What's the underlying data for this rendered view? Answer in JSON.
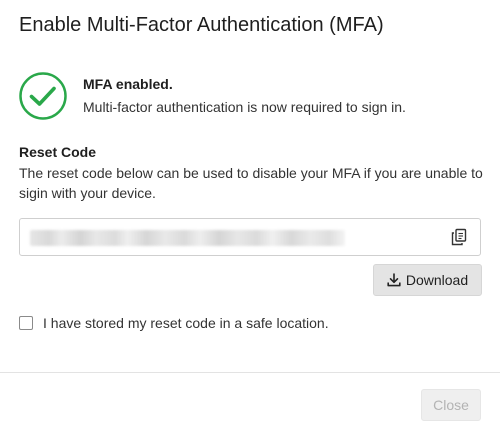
{
  "dialog": {
    "title": "Enable Multi-Factor Authentication (MFA)"
  },
  "status": {
    "icon": "check-circle-icon",
    "heading": "MFA enabled.",
    "description": "Multi-factor authentication is now required to sign in.",
    "color": "#2aa84a"
  },
  "reset_code": {
    "title": "Reset Code",
    "description": "The reset code below can be used to disable your MFA if you are unable to sigin with your device.",
    "value_obscured": true,
    "copy_icon": "copy-icon"
  },
  "actions": {
    "download_label": "Download",
    "download_icon": "download-icon",
    "confirm_label": "I have stored my reset code in a safe location.",
    "confirm_checked": false,
    "close_label": "Close",
    "close_disabled": true
  }
}
